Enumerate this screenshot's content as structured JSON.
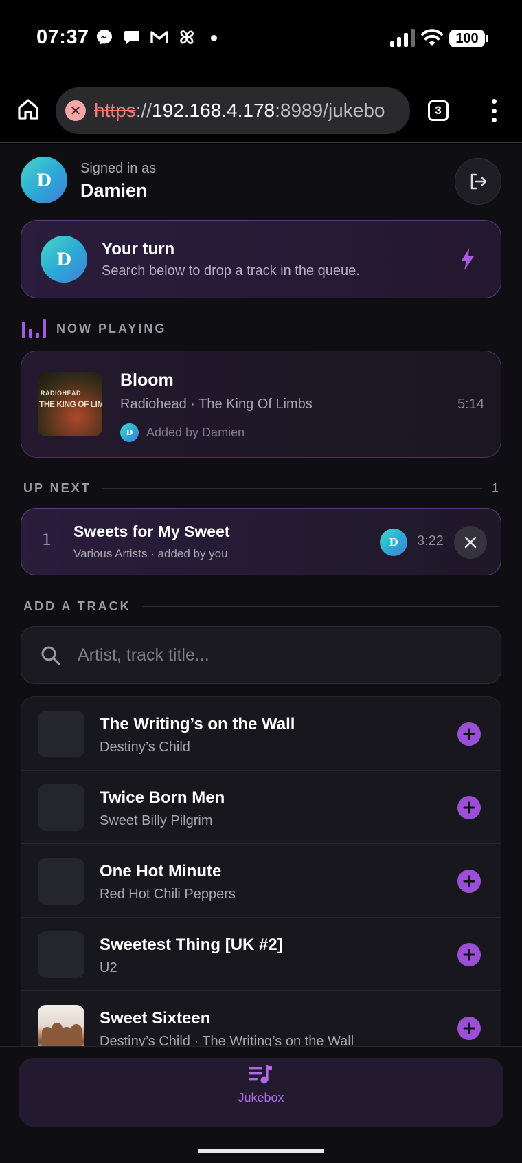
{
  "status_bar": {
    "time": "07:37",
    "battery": "100",
    "notification_icons": [
      "messenger-icon",
      "chat-bubble-icon",
      "gmail-icon",
      "pinwheel-icon"
    ]
  },
  "browser": {
    "url_protocol": "https",
    "url_separator": "://",
    "url_host": "192.168.4.178",
    "url_path": ":8989/jukebo",
    "tab_count": "3"
  },
  "user": {
    "signed_in_label": "Signed in as",
    "name": "Damien",
    "initial": "D"
  },
  "turn_card": {
    "title": "Your turn",
    "subtitle": "Search below to drop a track in the queue."
  },
  "now_playing": {
    "section_label": "NOW PLAYING",
    "title": "Bloom",
    "subtitle": "Radiohead · The King Of Limbs",
    "duration": "5:14",
    "added_by": "Added by Damien",
    "added_initial": "D",
    "album_art_text_1": "RADIOHEAD",
    "album_art_text_2": "THE KING OF LIMBS"
  },
  "up_next": {
    "section_label": "UP NEXT",
    "count": "1",
    "items": [
      {
        "position": "1",
        "title": "Sweets for My Sweet",
        "subtitle": "Various Artists · added by you",
        "initial": "D",
        "duration": "3:22"
      }
    ]
  },
  "add_track": {
    "section_label": "ADD A TRACK",
    "search_placeholder": "Artist, track title...",
    "search_value": ""
  },
  "results": [
    {
      "title": "The Writing’s on the Wall",
      "subtitle": "Destiny’s Child"
    },
    {
      "title": "Twice Born Men",
      "subtitle": "Sweet Billy Pilgrim"
    },
    {
      "title": "One Hot Minute",
      "subtitle": "Red Hot Chili Peppers"
    },
    {
      "title": "Sweetest Thing [UK #2]",
      "subtitle": "U2"
    },
    {
      "title": "Sweet Sixteen",
      "subtitle": "Destiny’s Child · The Writing’s on the Wall"
    }
  ],
  "bottom_nav": {
    "jukebox_label": "Jukebox"
  },
  "colors": {
    "accent": "#9b4fd6",
    "background": "#0f0f13",
    "card_border": "#5b3a7c"
  }
}
